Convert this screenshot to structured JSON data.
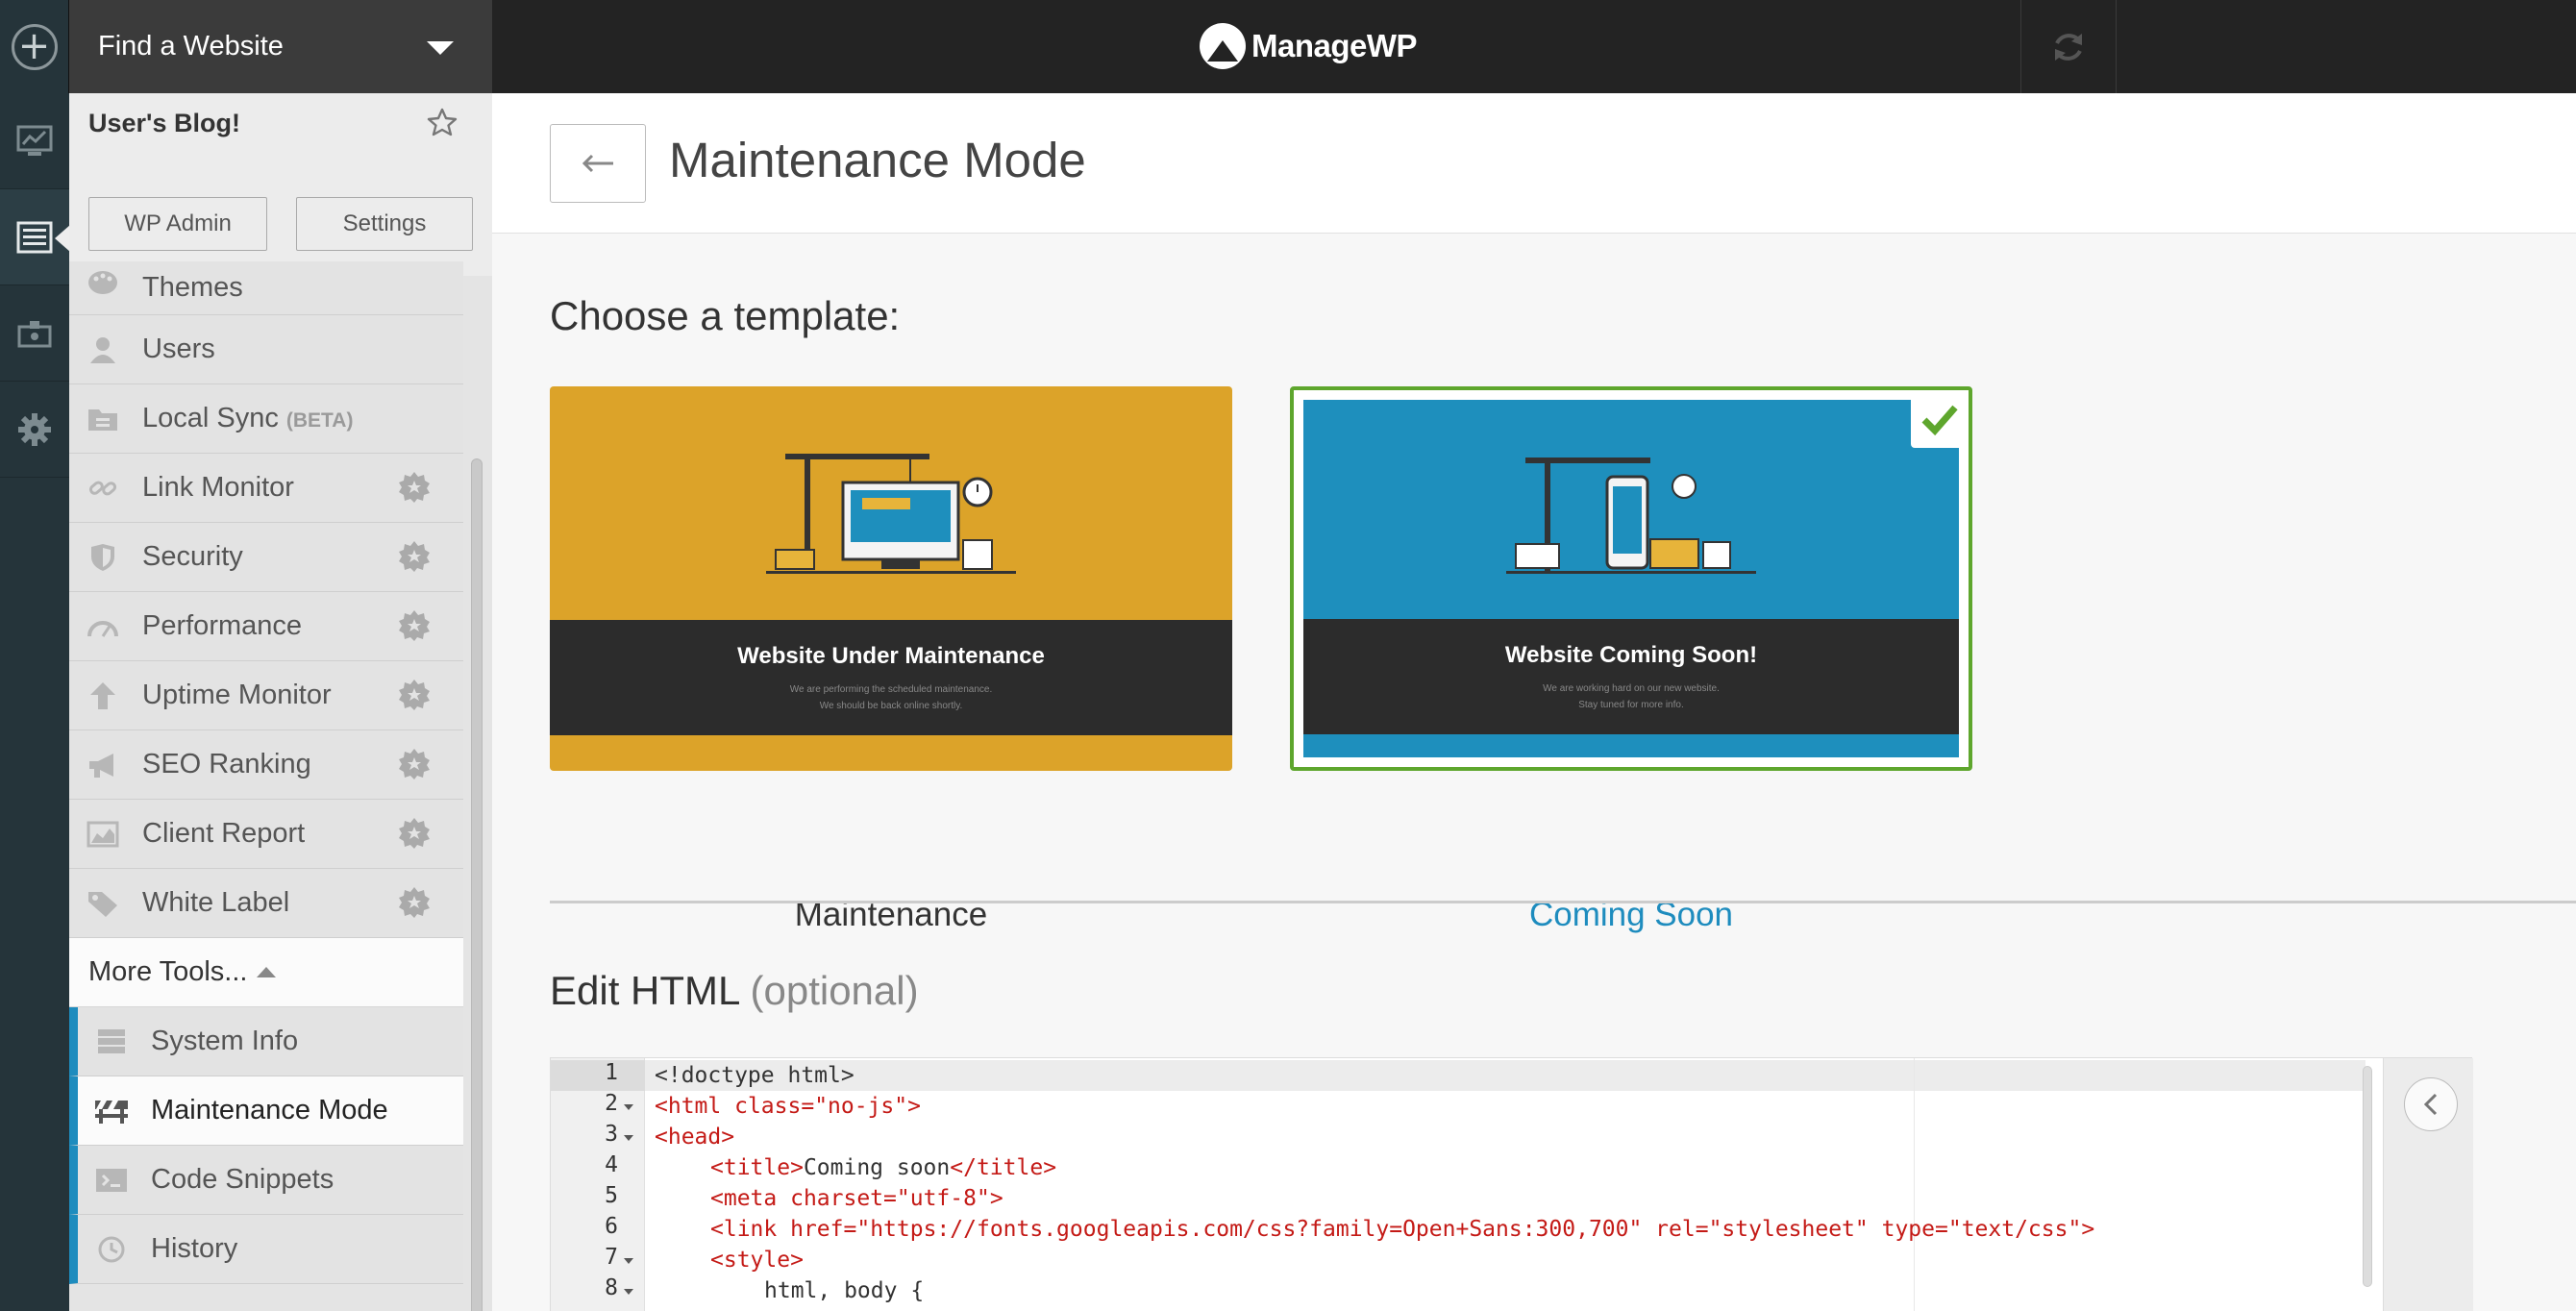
{
  "topbar": {
    "site_picker_label": "Find a Website",
    "brand": "ManageWP"
  },
  "sidebar": {
    "site_name": "User's Blog!",
    "wp_admin_label": "WP Admin",
    "settings_label": "Settings",
    "items": [
      {
        "label": "Themes"
      },
      {
        "label": "Users"
      },
      {
        "label": "Local Sync",
        "badge": "(BETA)"
      },
      {
        "label": "Link Monitor"
      },
      {
        "label": "Security"
      },
      {
        "label": "Performance"
      },
      {
        "label": "Uptime Monitor"
      },
      {
        "label": "SEO Ranking"
      },
      {
        "label": "Client Report"
      },
      {
        "label": "White Label"
      }
    ],
    "more_tools_label": "More Tools...",
    "sub_items": [
      {
        "label": "System Info"
      },
      {
        "label": "Maintenance Mode"
      },
      {
        "label": "Code Snippets"
      },
      {
        "label": "History"
      }
    ]
  },
  "main": {
    "title": "Maintenance Mode",
    "choose_label": "Choose a template:",
    "templates": [
      {
        "name": "Maintenance",
        "heading": "Website Under Maintenance",
        "line1": "We are performing the scheduled maintenance.",
        "line2": "We should be back online shortly.",
        "selected": false
      },
      {
        "name": "Coming Soon",
        "heading": "Website Coming Soon!",
        "line1": "We are working hard on our new website.",
        "line2": "Stay tuned for more info.",
        "selected": true
      }
    ],
    "edit_html_label": "Edit HTML",
    "edit_html_optional": "(optional)"
  },
  "editor": {
    "line_numbers": [
      "1",
      "2",
      "3",
      "4",
      "5",
      "6",
      "7",
      "8"
    ],
    "lines": [
      {
        "t1": "<!doctype html>"
      },
      {
        "tag_open": "<html ",
        "attr": "class=",
        "str": "\"no-js\"",
        "tag_close": ">"
      },
      {
        "tag_open": "<head>"
      },
      {
        "tag_open": "<title>",
        "text": "Coming soon",
        "tag_close": "</title>"
      },
      {
        "tag_open": "<meta ",
        "attr": "charset=",
        "str": "\"utf-8\"",
        "tag_close": ">"
      },
      {
        "tag_open": "<link ",
        "attr": "href=",
        "str": "\"https://fonts.googleapis.com/css?family=Open+Sans:300,700\"",
        "attr2": " rel=",
        "str2": "\"stylesheet\"",
        "attr3": " type=",
        "str3": "\"text/css\"",
        "tag_close": ">"
      },
      {
        "tag_open": "<style>"
      },
      {
        "text": "html, body {"
      }
    ]
  },
  "colors": {
    "accent": "#1e8cbe",
    "selected_border": "#5ea62d",
    "topbar": "#232323",
    "rail": "#25343a"
  }
}
